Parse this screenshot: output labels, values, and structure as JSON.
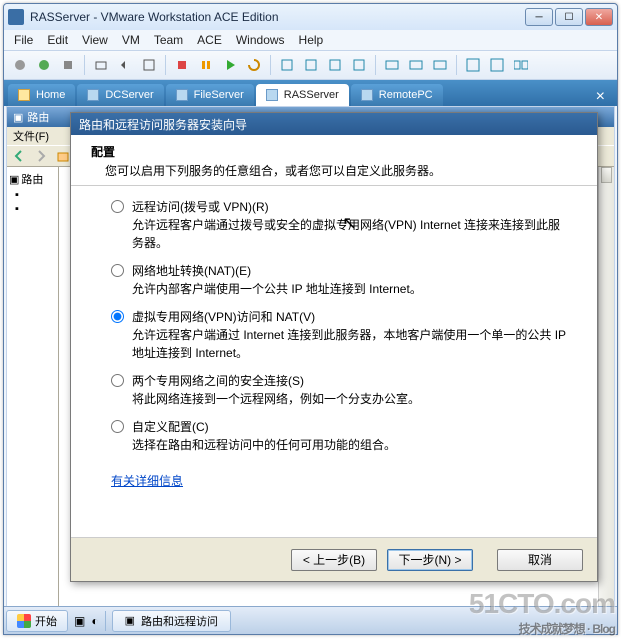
{
  "vmware": {
    "title": "RASServer - VMware Workstation ACE Edition",
    "menu": [
      "File",
      "Edit",
      "View",
      "VM",
      "Team",
      "ACE",
      "Windows",
      "Help"
    ],
    "tabs": [
      {
        "label": "Home",
        "active": false,
        "kind": "home"
      },
      {
        "label": "DCServer",
        "active": false
      },
      {
        "label": "FileServer",
        "active": false
      },
      {
        "label": "RASServer",
        "active": true
      },
      {
        "label": "RemotePC",
        "active": false
      }
    ]
  },
  "mmc": {
    "title_prefix": "路由",
    "menu_prefix": "文件(F)",
    "tree_root": "路由"
  },
  "wizard": {
    "title": "路由和远程访问服务器安装向导",
    "header_title": "配置",
    "header_sub": "您可以启用下列服务的任意组合，或者您可以自定义此服务器。",
    "options": [
      {
        "label": "远程访问(拨号或 VPN)(R)",
        "desc": "允许远程客户端通过拨号或安全的虚拟专用网络(VPN) Internet 连接来连接到此服务器。",
        "checked": false
      },
      {
        "label": "网络地址转换(NAT)(E)",
        "desc": "允许内部客户端使用一个公共 IP 地址连接到 Internet。",
        "checked": false
      },
      {
        "label": "虚拟专用网络(VPN)访问和 NAT(V)",
        "desc": "允许远程客户端通过 Internet 连接到此服务器，本地客户端使用一个单一的公共 IP 地址连接到 Internet。",
        "checked": true
      },
      {
        "label": "两个专用网络之间的安全连接(S)",
        "desc": "将此网络连接到一个远程网络，例如一个分支办公室。",
        "checked": false
      },
      {
        "label": "自定义配置(C)",
        "desc": "选择在路由和远程访问中的任何可用功能的组合。",
        "checked": false
      }
    ],
    "more_info": "有关详细信息",
    "buttons": {
      "back": "< 上一步(B)",
      "next": "下一步(N) >",
      "cancel": "取消"
    }
  },
  "taskbar": {
    "start": "开始",
    "task1": "路由和远程访问"
  },
  "watermark": {
    "main": "51CTO.com",
    "sub": "技术成就梦想 · Blog"
  }
}
